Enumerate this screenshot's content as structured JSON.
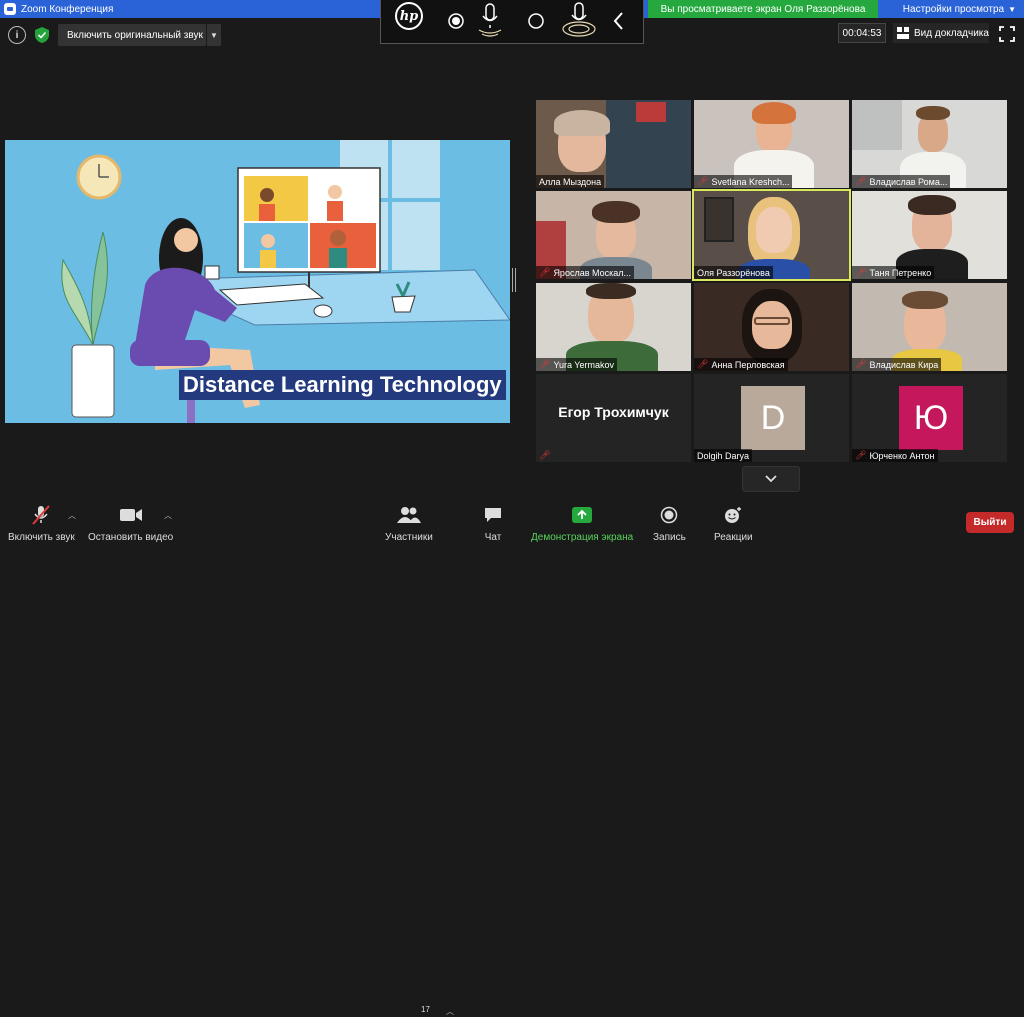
{
  "window": {
    "title": "Zoom Конференция"
  },
  "hp_toolbar": {
    "logo": "hp"
  },
  "share_banner": "Вы просматриваете экран Оля Раззорёнова",
  "view_options": "Настройки просмотра",
  "info_label": "i",
  "original_sound": "Включить оригинальный звук",
  "timer": "00:04:53",
  "speaker_view": "Вид докладчика",
  "shared_caption": "Distance Learning Technology",
  "tiles": [
    {
      "name": "Алла Мыздона",
      "muted": false
    },
    {
      "name": "Svetlana Krеshch...",
      "muted": true
    },
    {
      "name": "Владислав Рома...",
      "muted": true
    },
    {
      "name": "Ярослав Москал...",
      "muted": true
    },
    {
      "name": "Оля Раззорёнова",
      "muted": false
    },
    {
      "name": "Таня Петренко",
      "muted": true
    },
    {
      "name": "Yura Yermakov",
      "muted": true
    },
    {
      "name": "Анна Перловская",
      "muted": true
    },
    {
      "name": "Владислав Кира",
      "muted": true
    },
    {
      "name": "Егор Трохимчук",
      "muted": true,
      "big_label": "Егор Трохимчук"
    },
    {
      "name": "Dolgih Darya",
      "muted": false,
      "avatar_letter": "D",
      "avatar_color": "#b9a99a"
    },
    {
      "name": "Юрченко Антон",
      "muted": true,
      "avatar_letter": "Ю",
      "avatar_color": "#c4175c"
    }
  ],
  "bottom_bar": {
    "audio": "Включить звук",
    "video": "Остановить видео",
    "participants": "Участники",
    "participants_count": "17",
    "chat": "Чат",
    "share": "Демонстрация экрана",
    "record": "Запись",
    "reactions": "Реакции",
    "leave": "Выйти"
  },
  "colors": {
    "titlebar": "#2a63d8",
    "share_green": "#25a93f",
    "leave_red": "#c42a2a",
    "active_border": "#d9e85a",
    "mute_red": "#e03a3a"
  }
}
